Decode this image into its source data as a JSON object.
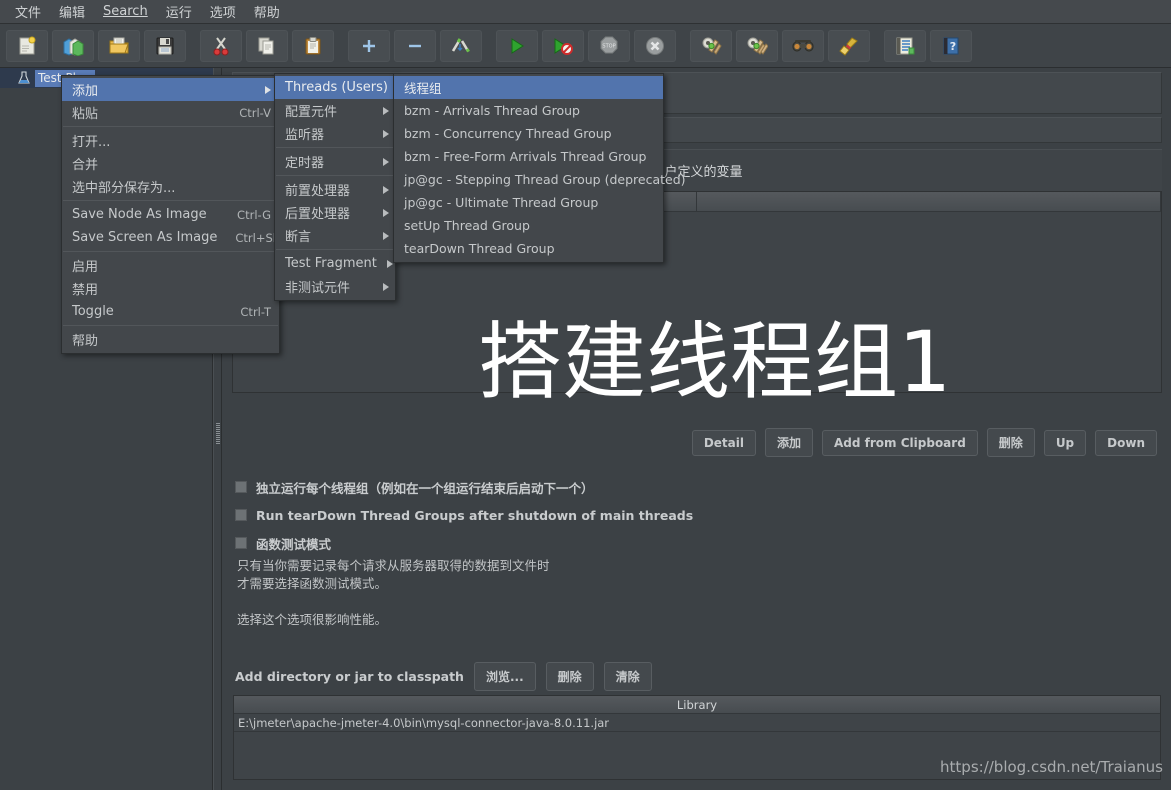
{
  "menubar": {
    "items": [
      {
        "label": "文件",
        "mnemonic": ""
      },
      {
        "label": "编辑",
        "mnemonic": ""
      },
      {
        "label": "Search",
        "mnemonic": "S"
      },
      {
        "label": "运行",
        "mnemonic": ""
      },
      {
        "label": "选项",
        "mnemonic": ""
      },
      {
        "label": "帮助",
        "mnemonic": ""
      }
    ]
  },
  "toolbar": {
    "buttons": [
      {
        "name": "new-icon",
        "title": "New"
      },
      {
        "name": "templates-icon",
        "title": "Templates"
      },
      {
        "name": "open-icon",
        "title": "Open"
      },
      {
        "name": "save-icon",
        "title": "Save"
      },
      {
        "name": "cut-icon",
        "title": "Cut"
      },
      {
        "name": "copy-icon",
        "title": "Copy"
      },
      {
        "name": "paste-icon",
        "title": "Paste"
      },
      {
        "name": "expand-all-icon",
        "title": "Expand All"
      },
      {
        "name": "collapse-all-icon",
        "title": "Collapse All"
      },
      {
        "name": "toggle-icon",
        "title": "Toggle"
      },
      {
        "name": "start-icon",
        "title": "Start"
      },
      {
        "name": "start-no-pause-icon",
        "title": "Start no timers"
      },
      {
        "name": "stop-icon",
        "title": "Stop"
      },
      {
        "name": "shutdown-icon",
        "title": "Shutdown"
      },
      {
        "name": "clear-icon",
        "title": "Clear"
      },
      {
        "name": "clear-all-icon",
        "title": "Clear All"
      },
      {
        "name": "search-icon",
        "title": "Search"
      },
      {
        "name": "reset-search-icon",
        "title": "Reset Search"
      },
      {
        "name": "function-helper-icon",
        "title": "Function Helper Dialog"
      },
      {
        "name": "help-icon",
        "title": "Help"
      }
    ]
  },
  "tree": {
    "root_label": "Test Plan"
  },
  "context_menu": {
    "items": [
      {
        "label": "添加",
        "accel": "",
        "submenu": true,
        "selected": true,
        "separator_after": false
      },
      {
        "label": "粘贴",
        "accel": "Ctrl-V",
        "submenu": false,
        "selected": false,
        "separator_after": true
      },
      {
        "label": "打开...",
        "accel": "",
        "submenu": false,
        "selected": false,
        "separator_after": false
      },
      {
        "label": "合并",
        "accel": "",
        "submenu": false,
        "selected": false,
        "separator_after": false
      },
      {
        "label": "选中部分保存为...",
        "accel": "",
        "submenu": false,
        "selected": false,
        "separator_after": true
      },
      {
        "label": "Save Node As Image",
        "accel": "Ctrl-G",
        "submenu": false,
        "selected": false,
        "separator_after": false
      },
      {
        "label": "Save Screen As Image",
        "accel": "Ctrl+Shift-G",
        "submenu": false,
        "selected": false,
        "separator_after": true
      },
      {
        "label": "启用",
        "accel": "",
        "submenu": false,
        "selected": false,
        "separator_after": false
      },
      {
        "label": "禁用",
        "accel": "",
        "submenu": false,
        "selected": false,
        "separator_after": false
      },
      {
        "label": "Toggle",
        "accel": "Ctrl-T",
        "submenu": false,
        "selected": false,
        "separator_after": true
      },
      {
        "label": "帮助",
        "accel": "",
        "submenu": false,
        "selected": false,
        "separator_after": false
      }
    ]
  },
  "add_menu": {
    "items": [
      {
        "label": "Threads (Users)",
        "submenu": true,
        "selected": true,
        "separator_after": false
      },
      {
        "label": "配置元件",
        "submenu": true,
        "selected": false,
        "separator_after": false
      },
      {
        "label": "监听器",
        "submenu": true,
        "selected": false,
        "separator_after": true
      },
      {
        "label": "定时器",
        "submenu": true,
        "selected": false,
        "separator_after": true
      },
      {
        "label": "前置处理器",
        "submenu": true,
        "selected": false,
        "separator_after": false
      },
      {
        "label": "后置处理器",
        "submenu": true,
        "selected": false,
        "separator_after": false
      },
      {
        "label": "断言",
        "submenu": true,
        "selected": false,
        "separator_after": true
      },
      {
        "label": "Test Fragment",
        "submenu": true,
        "selected": false,
        "separator_after": false
      },
      {
        "label": "非测试元件",
        "submenu": true,
        "selected": false,
        "separator_after": false
      }
    ]
  },
  "threads_menu": {
    "items": [
      {
        "label": "线程组",
        "selected": true
      },
      {
        "label": "bzm - Arrivals Thread Group",
        "selected": false
      },
      {
        "label": "bzm - Concurrency Thread Group",
        "selected": false
      },
      {
        "label": "bzm - Free-Form Arrivals Thread Group",
        "selected": false
      },
      {
        "label": "jp@gc - Stepping Thread Group (deprecated)",
        "selected": false
      },
      {
        "label": "jp@gc - Ultimate Thread Group",
        "selected": false
      },
      {
        "label": "setUp Thread Group",
        "selected": false
      },
      {
        "label": "tearDown Thread Group",
        "selected": false
      }
    ]
  },
  "test_plan": {
    "name_value": "",
    "comment_value": "",
    "udv_title": "用户定义的变量",
    "udv_columns": [
      "",
      ""
    ],
    "udv_rows": [],
    "action_buttons": [
      {
        "label": "Detail"
      },
      {
        "label": "添加"
      },
      {
        "label": "Add from Clipboard"
      },
      {
        "label": "删除"
      },
      {
        "label": "Up"
      },
      {
        "label": "Down"
      }
    ],
    "checkboxes": [
      {
        "label": "独立运行每个线程组（例如在一个组运行结束后启动下一个）",
        "checked": false
      },
      {
        "label": "Run tearDown Thread Groups after shutdown of main threads",
        "checked": false
      },
      {
        "label": "函数测试模式",
        "checked": false
      }
    ],
    "note_line1": "只有当你需要记录每个请求从服务器取得的数据到文件时",
    "note_line2": "才需要选择函数测试模式。",
    "note_line3": "选择这个选项很影响性能。",
    "classpath_label": "Add directory or jar to classpath",
    "classpath_buttons": [
      {
        "label": "浏览..."
      },
      {
        "label": "删除"
      },
      {
        "label": "清除"
      }
    ],
    "library_header": "Library",
    "library_rows": [
      "E:\\jmeter\\apache-jmeter-4.0\\bin\\mysql-connector-java-8.0.11.jar"
    ]
  },
  "overlay": {
    "title": "搭建线程组1"
  },
  "watermark": {
    "text": "https://blog.csdn.net/Traianus"
  },
  "colors": {
    "window_bg": "#3c4145",
    "toolbar_bg": "#3f4448",
    "menu_bg": "#43474b",
    "highlight": "#5274ad",
    "tree_select": "#5a7cb8",
    "text": "#c6c9cb",
    "overlay_text": "#ffffff"
  }
}
